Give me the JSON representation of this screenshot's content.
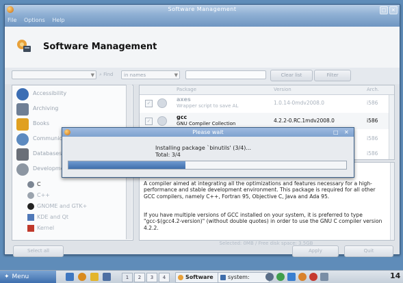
{
  "window": {
    "title": "Software Management",
    "menubar": [
      "File",
      "Options",
      "Help"
    ],
    "heading": "Software Management"
  },
  "toolbar": {
    "view_select": "",
    "find_label": "Find",
    "search_in_select": "in names",
    "search_value": "",
    "button_1": "Clear list",
    "button_2": "Filter"
  },
  "categories": [
    {
      "label": "Accessibility",
      "icon": "accessibility-icon"
    },
    {
      "label": "Archiving",
      "icon": "archive-icon"
    },
    {
      "label": "Books",
      "icon": "book-icon"
    },
    {
      "label": "Communications",
      "icon": "communications-icon"
    },
    {
      "label": "Databases",
      "icon": "database-icon"
    },
    {
      "label": "Development",
      "icon": "development-icon"
    }
  ],
  "subcategories": [
    {
      "label": "C",
      "icon": "gear-icon"
    },
    {
      "label": "C++",
      "icon": "gear-icon"
    },
    {
      "label": "GNOME and GTK+",
      "icon": "gnome-icon"
    },
    {
      "label": "KDE and Qt",
      "icon": "kde-icon"
    },
    {
      "label": "Kernel",
      "icon": "kernel-icon"
    }
  ],
  "packages": {
    "columns": [
      "",
      "",
      "Package",
      "Version",
      "Arch."
    ],
    "rows": [
      {
        "name": "axes",
        "description": "Wrapper script to save AL",
        "version": "1.0.14-0mdv2008.0",
        "arch": "i586",
        "dim": true
      },
      {
        "name": "gcc",
        "description": "GNU Compiler Collection",
        "version": "4.2.2-0.RC.1mdv2008.0",
        "arch": "i586",
        "dim": false
      },
      {
        "name": "",
        "description": "",
        "version": "",
        "arch": "i586",
        "dim": true
      },
      {
        "name": "",
        "description": "",
        "version": "",
        "arch": "i586",
        "dim": true
      }
    ]
  },
  "description": {
    "para1": "A compiler aimed at integrating all the optimizations and features necessary for a high-performance and stable development environment. This package is required for all other GCC compilers, namely C++, Fortran 95, Objective C, Java and Ada 95.",
    "para2": "If you have multiple versions of GCC installed on your system, it is preferred to type \"gcc-$(gcc4.2-version)\" (without double quotes) in order to use the GNU C compiler version 4.2.2."
  },
  "status_text": "Selected: 0MB / Free disk space: 3.5GB",
  "buttons": {
    "select_all": "Select all",
    "apply": "Apply",
    "quit": "Quit"
  },
  "dialog": {
    "title": "Please wait",
    "message_line1": "Installing package `binutils' (3/4)...",
    "message_line2": "Total: 3/4",
    "progress": 0.42
  },
  "taskbar": {
    "menu_label": "Menu",
    "desktops": [
      "1",
      "2",
      "3",
      "4"
    ],
    "tasks": [
      {
        "label": "Software",
        "icon": "software-task-icon"
      },
      {
        "label": "system:",
        "icon": "terminal-task-icon"
      }
    ],
    "clock": "14"
  },
  "colors": {
    "accent": "#3f6eab",
    "titlebar": "#8fb0d4",
    "desktop": "#5f8cb9"
  }
}
